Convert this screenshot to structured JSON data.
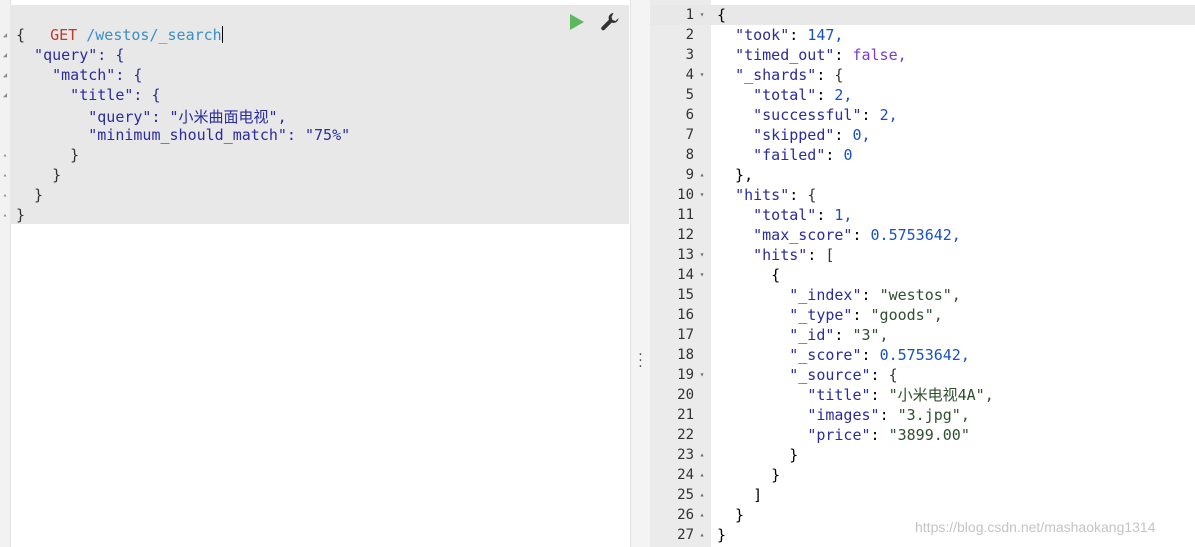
{
  "request": {
    "method": "GET",
    "path": "/westos/_search",
    "body_lines": [
      "{",
      "  \"query\": {",
      "    \"match\": {",
      "      \"title\": {",
      "        \"query\": \"小米曲面电视\",",
      "        \"minimum_should_match\": \"75%\"",
      "      }",
      "    }",
      "  }",
      "}"
    ]
  },
  "response": {
    "line_numbers": [
      "1",
      "2",
      "3",
      "4",
      "5",
      "6",
      "7",
      "8",
      "9",
      "10",
      "11",
      "12",
      "13",
      "14",
      "15",
      "16",
      "17",
      "18",
      "19",
      "20",
      "21",
      "22",
      "23",
      "24",
      "25",
      "26",
      "27"
    ],
    "lines": [
      "{",
      "  \"took\": 147,",
      "  \"timed_out\": false,",
      "  \"_shards\": {",
      "    \"total\": 2,",
      "    \"successful\": 2,",
      "    \"skipped\": 0,",
      "    \"failed\": 0",
      "  },",
      "  \"hits\": {",
      "    \"total\": 1,",
      "    \"max_score\": 0.5753642,",
      "    \"hits\": [",
      "      {",
      "        \"_index\": \"westos\",",
      "        \"_type\": \"goods\",",
      "        \"_id\": \"3\",",
      "        \"_score\": 0.5753642,",
      "        \"_source\": {",
      "          \"title\": \"小米电视4A\",",
      "          \"images\": \"3.jpg\",",
      "          \"price\": \"3899.00\"",
      "        }",
      "      }",
      "    ]",
      "  }",
      "}"
    ]
  },
  "toolbar": {
    "run_icon": "play-icon",
    "settings_icon": "wrench-icon",
    "run_color": "#5cb85c"
  },
  "watermark": "https://blog.csdn.net/mashaokang1314"
}
